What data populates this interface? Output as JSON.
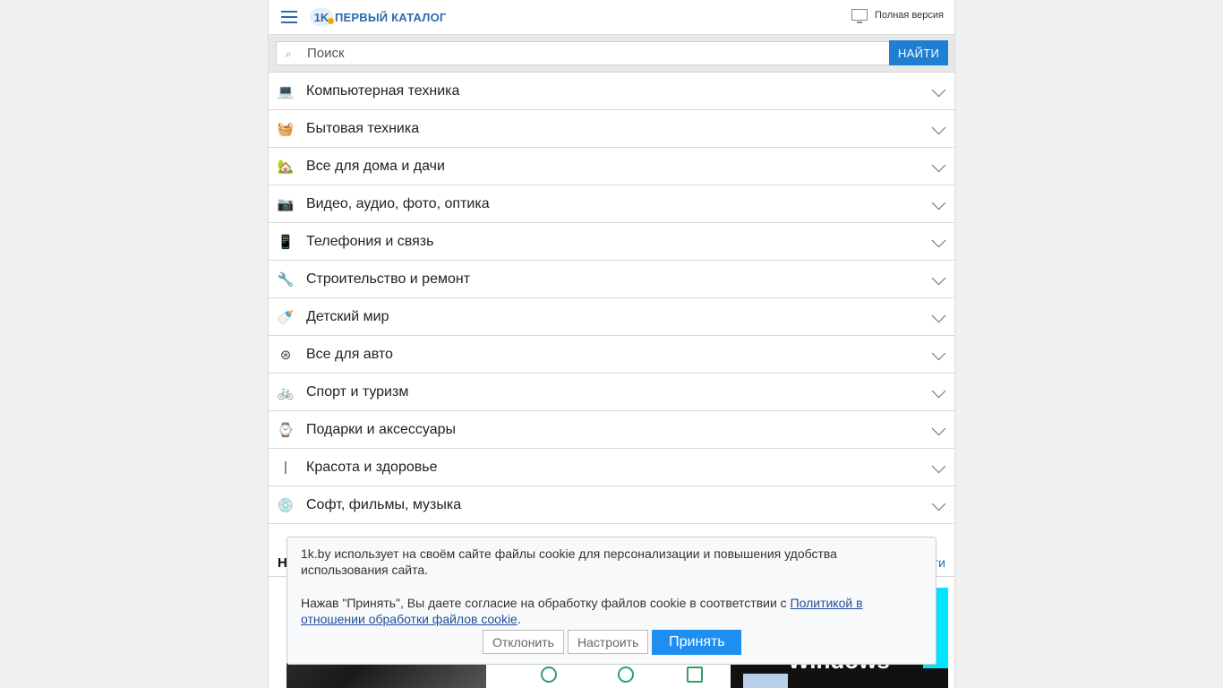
{
  "header": {
    "logo_mark": "1K",
    "logo_text": "ПЕРВЫЙ КАТАЛОГ",
    "full_version": "Полная версия"
  },
  "search": {
    "placeholder": "Поиск",
    "button": "НАЙТИ"
  },
  "categories": [
    {
      "label": "Компьютерная техника",
      "icon": "laptop-icon",
      "glyph": "💻"
    },
    {
      "label": "Бытовая техника",
      "icon": "washing-machine-icon",
      "glyph": "🧺"
    },
    {
      "label": "Все для дома и дачи",
      "icon": "lawn-mower-icon",
      "glyph": "🏡"
    },
    {
      "label": "Видео, аудио, фото, оптика",
      "icon": "camera-icon",
      "glyph": "📷"
    },
    {
      "label": "Телефония и связь",
      "icon": "phone-icon",
      "glyph": "📱"
    },
    {
      "label": "Строительство и ремонт",
      "icon": "drill-icon",
      "glyph": "🔧"
    },
    {
      "label": "Детский мир",
      "icon": "stroller-icon",
      "glyph": "🍼"
    },
    {
      "label": "Все для авто",
      "icon": "wheel-icon",
      "glyph": "⊛"
    },
    {
      "label": "Спорт и туризм",
      "icon": "bicycle-icon",
      "glyph": "🚲"
    },
    {
      "label": "Подарки и аксессуары",
      "icon": "watch-icon",
      "glyph": "⌚"
    },
    {
      "label": "Красота и здоровье",
      "icon": "toothbrush-icon",
      "glyph": "|"
    },
    {
      "label": "Софт, фильмы, музыка",
      "icon": "disc-icon",
      "glyph": "💿"
    }
  ],
  "news": {
    "title": "Н",
    "more": "ти"
  },
  "thumb3": {
    "text": "Windows"
  },
  "cookie": {
    "text1": "1k.by использует на своём сайте файлы cookie для персонализации и повышения удобства использования сайта.",
    "text2_prefix": "Нажав \"Принять\", Вы даете согласие на обработку файлов cookie в соответствии с ",
    "policy_link": "Политикой в отношении обработки файлов cookie",
    "text2_suffix": ".",
    "decline": "Отклонить",
    "settings": "Настроить",
    "accept": "Принять"
  },
  "colors": {
    "accent": "#1f7fd0",
    "accept": "#1e8ff0",
    "link": "#1f4f99"
  }
}
